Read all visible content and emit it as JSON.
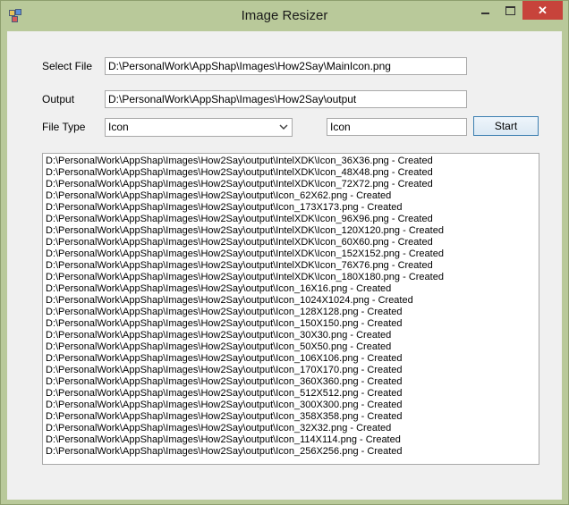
{
  "window": {
    "title": "Image Resizer"
  },
  "title_controls": {
    "close_glyph": "✕"
  },
  "form": {
    "select_file_label": "Select File",
    "select_file_value": "D:\\PersonalWork\\AppShap\\Images\\How2Say\\MainIcon.png",
    "output_label": "Output",
    "output_value": "D:\\PersonalWork\\AppShap\\Images\\How2Say\\output",
    "file_type_label": "File Type",
    "file_type_selected": "Icon",
    "name_value": "Icon",
    "start_label": "Start"
  },
  "log": {
    "lines": [
      "D:\\PersonalWork\\AppShap\\Images\\How2Say\\output\\IntelXDK\\Icon_36X36.png - Created",
      "D:\\PersonalWork\\AppShap\\Images\\How2Say\\output\\IntelXDK\\Icon_48X48.png - Created",
      "D:\\PersonalWork\\AppShap\\Images\\How2Say\\output\\IntelXDK\\Icon_72X72.png - Created",
      "D:\\PersonalWork\\AppShap\\Images\\How2Say\\output\\Icon_62X62.png - Created",
      "D:\\PersonalWork\\AppShap\\Images\\How2Say\\output\\Icon_173X173.png - Created",
      "D:\\PersonalWork\\AppShap\\Images\\How2Say\\output\\IntelXDK\\Icon_96X96.png - Created",
      "D:\\PersonalWork\\AppShap\\Images\\How2Say\\output\\IntelXDK\\Icon_120X120.png - Created",
      "D:\\PersonalWork\\AppShap\\Images\\How2Say\\output\\IntelXDK\\Icon_60X60.png - Created",
      "D:\\PersonalWork\\AppShap\\Images\\How2Say\\output\\IntelXDK\\Icon_152X152.png - Created",
      "D:\\PersonalWork\\AppShap\\Images\\How2Say\\output\\IntelXDK\\Icon_76X76.png - Created",
      "D:\\PersonalWork\\AppShap\\Images\\How2Say\\output\\IntelXDK\\Icon_180X180.png - Created",
      "D:\\PersonalWork\\AppShap\\Images\\How2Say\\output\\Icon_16X16.png - Created",
      "D:\\PersonalWork\\AppShap\\Images\\How2Say\\output\\Icon_1024X1024.png - Created",
      "D:\\PersonalWork\\AppShap\\Images\\How2Say\\output\\Icon_128X128.png - Created",
      "D:\\PersonalWork\\AppShap\\Images\\How2Say\\output\\Icon_150X150.png - Created",
      "D:\\PersonalWork\\AppShap\\Images\\How2Say\\output\\Icon_30X30.png - Created",
      "D:\\PersonalWork\\AppShap\\Images\\How2Say\\output\\Icon_50X50.png - Created",
      "D:\\PersonalWork\\AppShap\\Images\\How2Say\\output\\Icon_106X106.png - Created",
      "D:\\PersonalWork\\AppShap\\Images\\How2Say\\output\\Icon_170X170.png - Created",
      "D:\\PersonalWork\\AppShap\\Images\\How2Say\\output\\Icon_360X360.png - Created",
      "D:\\PersonalWork\\AppShap\\Images\\How2Say\\output\\Icon_512X512.png - Created",
      "D:\\PersonalWork\\AppShap\\Images\\How2Say\\output\\Icon_300X300.png - Created",
      "D:\\PersonalWork\\AppShap\\Images\\How2Say\\output\\Icon_358X358.png - Created",
      "D:\\PersonalWork\\AppShap\\Images\\How2Say\\output\\Icon_32X32.png - Created",
      "D:\\PersonalWork\\AppShap\\Images\\How2Say\\output\\Icon_114X114.png - Created",
      "D:\\PersonalWork\\AppShap\\Images\\How2Say\\output\\Icon_256X256.png - Created"
    ]
  },
  "icons": {
    "app": "app-window-icon",
    "minimize": "minimize-icon",
    "maximize": "maximize-icon",
    "close": "close-icon",
    "dropdown": "chevron-down-icon"
  },
  "colors": {
    "window_frame": "#b9c99a",
    "close_button": "#c7433b",
    "button_border": "#3c7fb1",
    "client_background": "#f0f0f0"
  }
}
